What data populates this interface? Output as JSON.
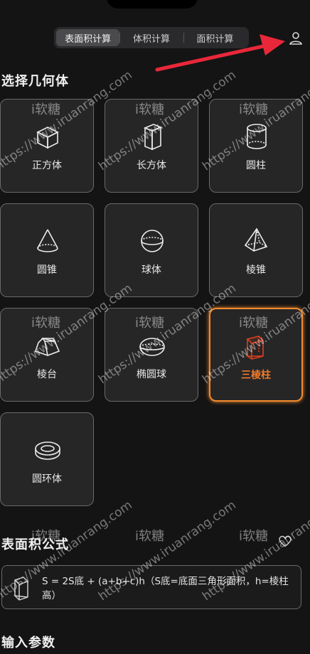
{
  "tabs": [
    {
      "label": "表面积计算",
      "active": true
    },
    {
      "label": "体积计算",
      "active": false
    },
    {
      "label": "面积计算",
      "active": false
    }
  ],
  "header": {
    "user_icon": "user-icon",
    "annotation_arrow_color": "#e8283a"
  },
  "shapes_section": {
    "title": "选择几何体",
    "items": [
      {
        "label": "正方体",
        "icon": "cube-icon",
        "selected": false
      },
      {
        "label": "长方体",
        "icon": "cuboid-icon",
        "selected": false
      },
      {
        "label": "圆柱",
        "icon": "cylinder-icon",
        "selected": false
      },
      {
        "label": "圆锥",
        "icon": "cone-icon",
        "selected": false
      },
      {
        "label": "球体",
        "icon": "sphere-icon",
        "selected": false
      },
      {
        "label": "棱锥",
        "icon": "pyramid-icon",
        "selected": false
      },
      {
        "label": "棱台",
        "icon": "frustum-icon",
        "selected": false
      },
      {
        "label": "椭圆球",
        "icon": "ellipsoid-icon",
        "selected": false
      },
      {
        "label": "三棱柱",
        "icon": "triangular-prism-icon",
        "selected": true
      },
      {
        "label": "圆环体",
        "icon": "torus-icon",
        "selected": false
      }
    ]
  },
  "formula_section": {
    "title": "表面积公式",
    "text": "S = 2S底 + (a+b+c)h（S底=底面三角形面积，h=棱柱高）"
  },
  "input_section": {
    "title": "输入参数"
  },
  "watermark": {
    "tag": "i软糖",
    "url": "https://www.iruanrang.com"
  },
  "colors": {
    "accent": "#f28a2e",
    "background": "#141414",
    "card": "#262627"
  }
}
